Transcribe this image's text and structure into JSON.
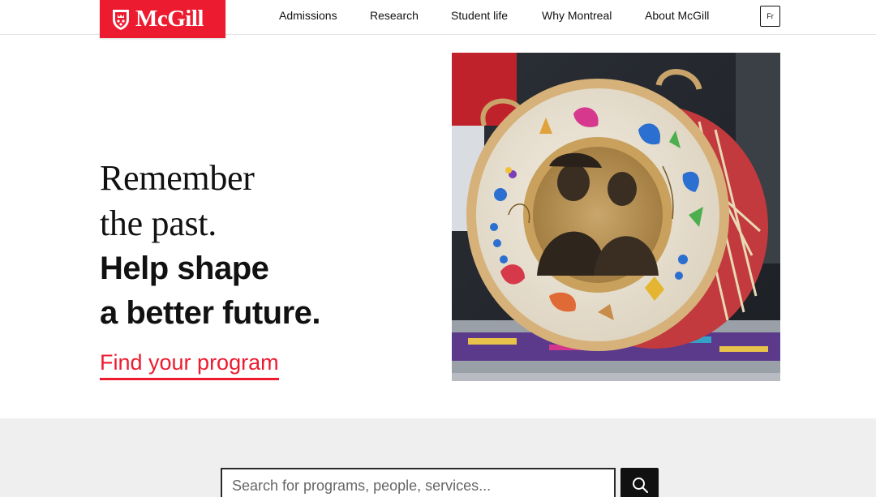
{
  "header": {
    "logo_text": "McGill",
    "nav": [
      {
        "label": "Admissions"
      },
      {
        "label": "Research"
      },
      {
        "label": "Student life"
      },
      {
        "label": "Why Montreal"
      },
      {
        "label": "About McGill"
      }
    ],
    "language_toggle": "Fr"
  },
  "hero": {
    "line1": "Remember",
    "line2": "the past.",
    "line3": "Help shape",
    "line4": "a better future.",
    "cta_label": "Find your program",
    "image_subject": "hand drum painted with floral designs and a sepia portrait of two people"
  },
  "search": {
    "placeholder": "Search for programs, people, services...",
    "value": "",
    "button_icon": "search-icon"
  },
  "colors": {
    "brand_red": "#ed1b2f",
    "text": "#111111",
    "search_band": "#efefef"
  }
}
